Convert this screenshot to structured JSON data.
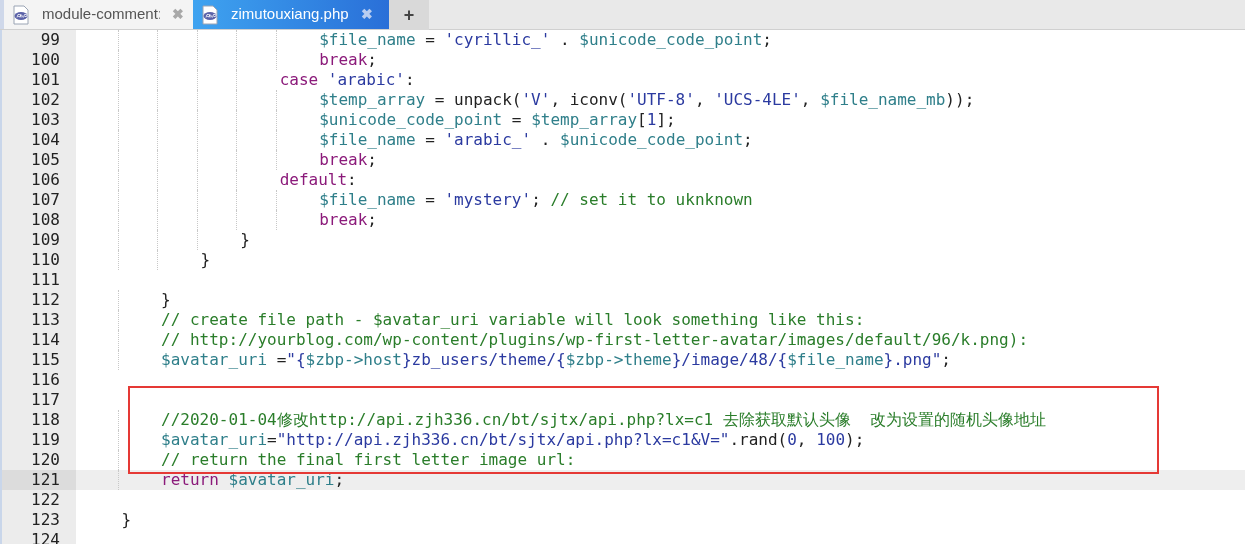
{
  "tabs": [
    {
      "label": "module-comment:",
      "selected": false,
      "close": "✖"
    },
    {
      "label": "zimutouxiang.php",
      "selected": true,
      "close": "✖"
    }
  ],
  "new_tab": "+",
  "lines": [
    {
      "number": "99",
      "tokens": [
        {
          "kind": "var",
          "text": "                        $file_name"
        },
        {
          "kind": "plain",
          "text": " = "
        },
        {
          "kind": "str",
          "text": "'cyrillic_'"
        },
        {
          "kind": "plain",
          "text": " . "
        },
        {
          "kind": "var",
          "text": "$unicode_code_point"
        },
        {
          "kind": "plain",
          "text": ";"
        }
      ]
    },
    {
      "number": "100",
      "tokens": [
        {
          "kind": "kw",
          "text": "                        break"
        },
        {
          "kind": "plain",
          "text": ";"
        }
      ]
    },
    {
      "number": "101",
      "tokens": [
        {
          "kind": "kw",
          "text": "                    case "
        },
        {
          "kind": "str",
          "text": "'arabic'"
        },
        {
          "kind": "plain",
          "text": ":"
        }
      ]
    },
    {
      "number": "102",
      "tokens": [
        {
          "kind": "var",
          "text": "                        $temp_array"
        },
        {
          "kind": "plain",
          "text": " = unpack("
        },
        {
          "kind": "str",
          "text": "'V'"
        },
        {
          "kind": "plain",
          "text": ", iconv("
        },
        {
          "kind": "str",
          "text": "'UTF-8'"
        },
        {
          "kind": "plain",
          "text": ", "
        },
        {
          "kind": "str",
          "text": "'UCS-4LE'"
        },
        {
          "kind": "plain",
          "text": ", "
        },
        {
          "kind": "var",
          "text": "$file_name_mb"
        },
        {
          "kind": "plain",
          "text": "));"
        }
      ]
    },
    {
      "number": "103",
      "tokens": [
        {
          "kind": "var",
          "text": "                        $unicode_code_point"
        },
        {
          "kind": "plain",
          "text": " = "
        },
        {
          "kind": "var",
          "text": "$temp_array"
        },
        {
          "kind": "plain",
          "text": "["
        },
        {
          "kind": "num",
          "text": "1"
        },
        {
          "kind": "plain",
          "text": "];"
        }
      ]
    },
    {
      "number": "104",
      "tokens": [
        {
          "kind": "var",
          "text": "                        $file_name"
        },
        {
          "kind": "plain",
          "text": " = "
        },
        {
          "kind": "str",
          "text": "'arabic_'"
        },
        {
          "kind": "plain",
          "text": " . "
        },
        {
          "kind": "var",
          "text": "$unicode_code_point"
        },
        {
          "kind": "plain",
          "text": ";"
        }
      ]
    },
    {
      "number": "105",
      "tokens": [
        {
          "kind": "kw",
          "text": "                        break"
        },
        {
          "kind": "plain",
          "text": ";"
        }
      ]
    },
    {
      "number": "106",
      "tokens": [
        {
          "kind": "kw",
          "text": "                    default"
        },
        {
          "kind": "plain",
          "text": ":"
        }
      ]
    },
    {
      "number": "107",
      "tokens": [
        {
          "kind": "var",
          "text": "                        $file_name"
        },
        {
          "kind": "plain",
          "text": " = "
        },
        {
          "kind": "str",
          "text": "'mystery'"
        },
        {
          "kind": "plain",
          "text": "; "
        },
        {
          "kind": "com",
          "text": "// set it to uknknown"
        }
      ]
    },
    {
      "number": "108",
      "tokens": [
        {
          "kind": "kw",
          "text": "                        break"
        },
        {
          "kind": "plain",
          "text": ";"
        }
      ]
    },
    {
      "number": "109",
      "tokens": [
        {
          "kind": "plain",
          "text": "                }"
        }
      ]
    },
    {
      "number": "110",
      "tokens": [
        {
          "kind": "plain",
          "text": "            }"
        }
      ]
    },
    {
      "number": "111"
    },
    {
      "number": "112",
      "tokens": [
        {
          "kind": "plain",
          "text": "        }"
        }
      ]
    },
    {
      "number": "113",
      "tokens": [
        {
          "kind": "com",
          "text": "        // create file path - $avatar_uri variable will look something like this:"
        }
      ]
    },
    {
      "number": "114",
      "tokens": [
        {
          "kind": "com",
          "text": "        // http://yourblog.com/wp-content/plugins/wp-first-letter-avatar/images/default/96/k.png):"
        }
      ]
    },
    {
      "number": "115",
      "tokens": [
        {
          "kind": "var",
          "text": "        $avatar_uri"
        },
        {
          "kind": "plain",
          "text": " ="
        },
        {
          "kind": "str",
          "text": "\"{"
        },
        {
          "kind": "var",
          "text": "$zbp->host"
        },
        {
          "kind": "str",
          "text": "}zb_users/theme/{"
        },
        {
          "kind": "var",
          "text": "$zbp->theme"
        },
        {
          "kind": "str",
          "text": "}/image/48/{"
        },
        {
          "kind": "var",
          "text": "$file_name"
        },
        {
          "kind": "str",
          "text": "}.png\""
        },
        {
          "kind": "plain",
          "text": ";"
        }
      ]
    },
    {
      "number": "116"
    },
    {
      "number": "117",
      "annotated": true
    },
    {
      "number": "118",
      "annotated": true,
      "tokens": [
        {
          "kind": "com",
          "text": "        //2020-01-04修改http://api.zjh336.cn/bt/sjtx/api.php?lx=c1 去除获取默认头像  改为设置的随机头像地址"
        }
      ]
    },
    {
      "number": "119",
      "annotated": true,
      "tokens": [
        {
          "kind": "var",
          "text": "        $avatar_uri"
        },
        {
          "kind": "plain",
          "text": "="
        },
        {
          "kind": "str",
          "text": "\"http://api.zjh336.cn/bt/sjtx/api.php?lx=c1&V=\""
        },
        {
          "kind": "plain",
          "text": ".rand("
        },
        {
          "kind": "num",
          "text": "0"
        },
        {
          "kind": "plain",
          "text": ", "
        },
        {
          "kind": "num",
          "text": "100"
        },
        {
          "kind": "plain",
          "text": ");"
        }
      ]
    },
    {
      "number": "120",
      "annotated": true,
      "tokens": [
        {
          "kind": "com",
          "text": "        // return the final first letter image url:"
        }
      ]
    },
    {
      "number": "121",
      "current": true,
      "tokens": [
        {
          "kind": "kw",
          "text": "        return "
        },
        {
          "kind": "var",
          "text": "$avatar_uri"
        },
        {
          "kind": "plain",
          "text": ";"
        }
      ]
    },
    {
      "number": "122"
    },
    {
      "number": "123",
      "tokens": [
        {
          "kind": "plain",
          "text": "    }"
        }
      ]
    },
    {
      "number": "124"
    }
  ]
}
